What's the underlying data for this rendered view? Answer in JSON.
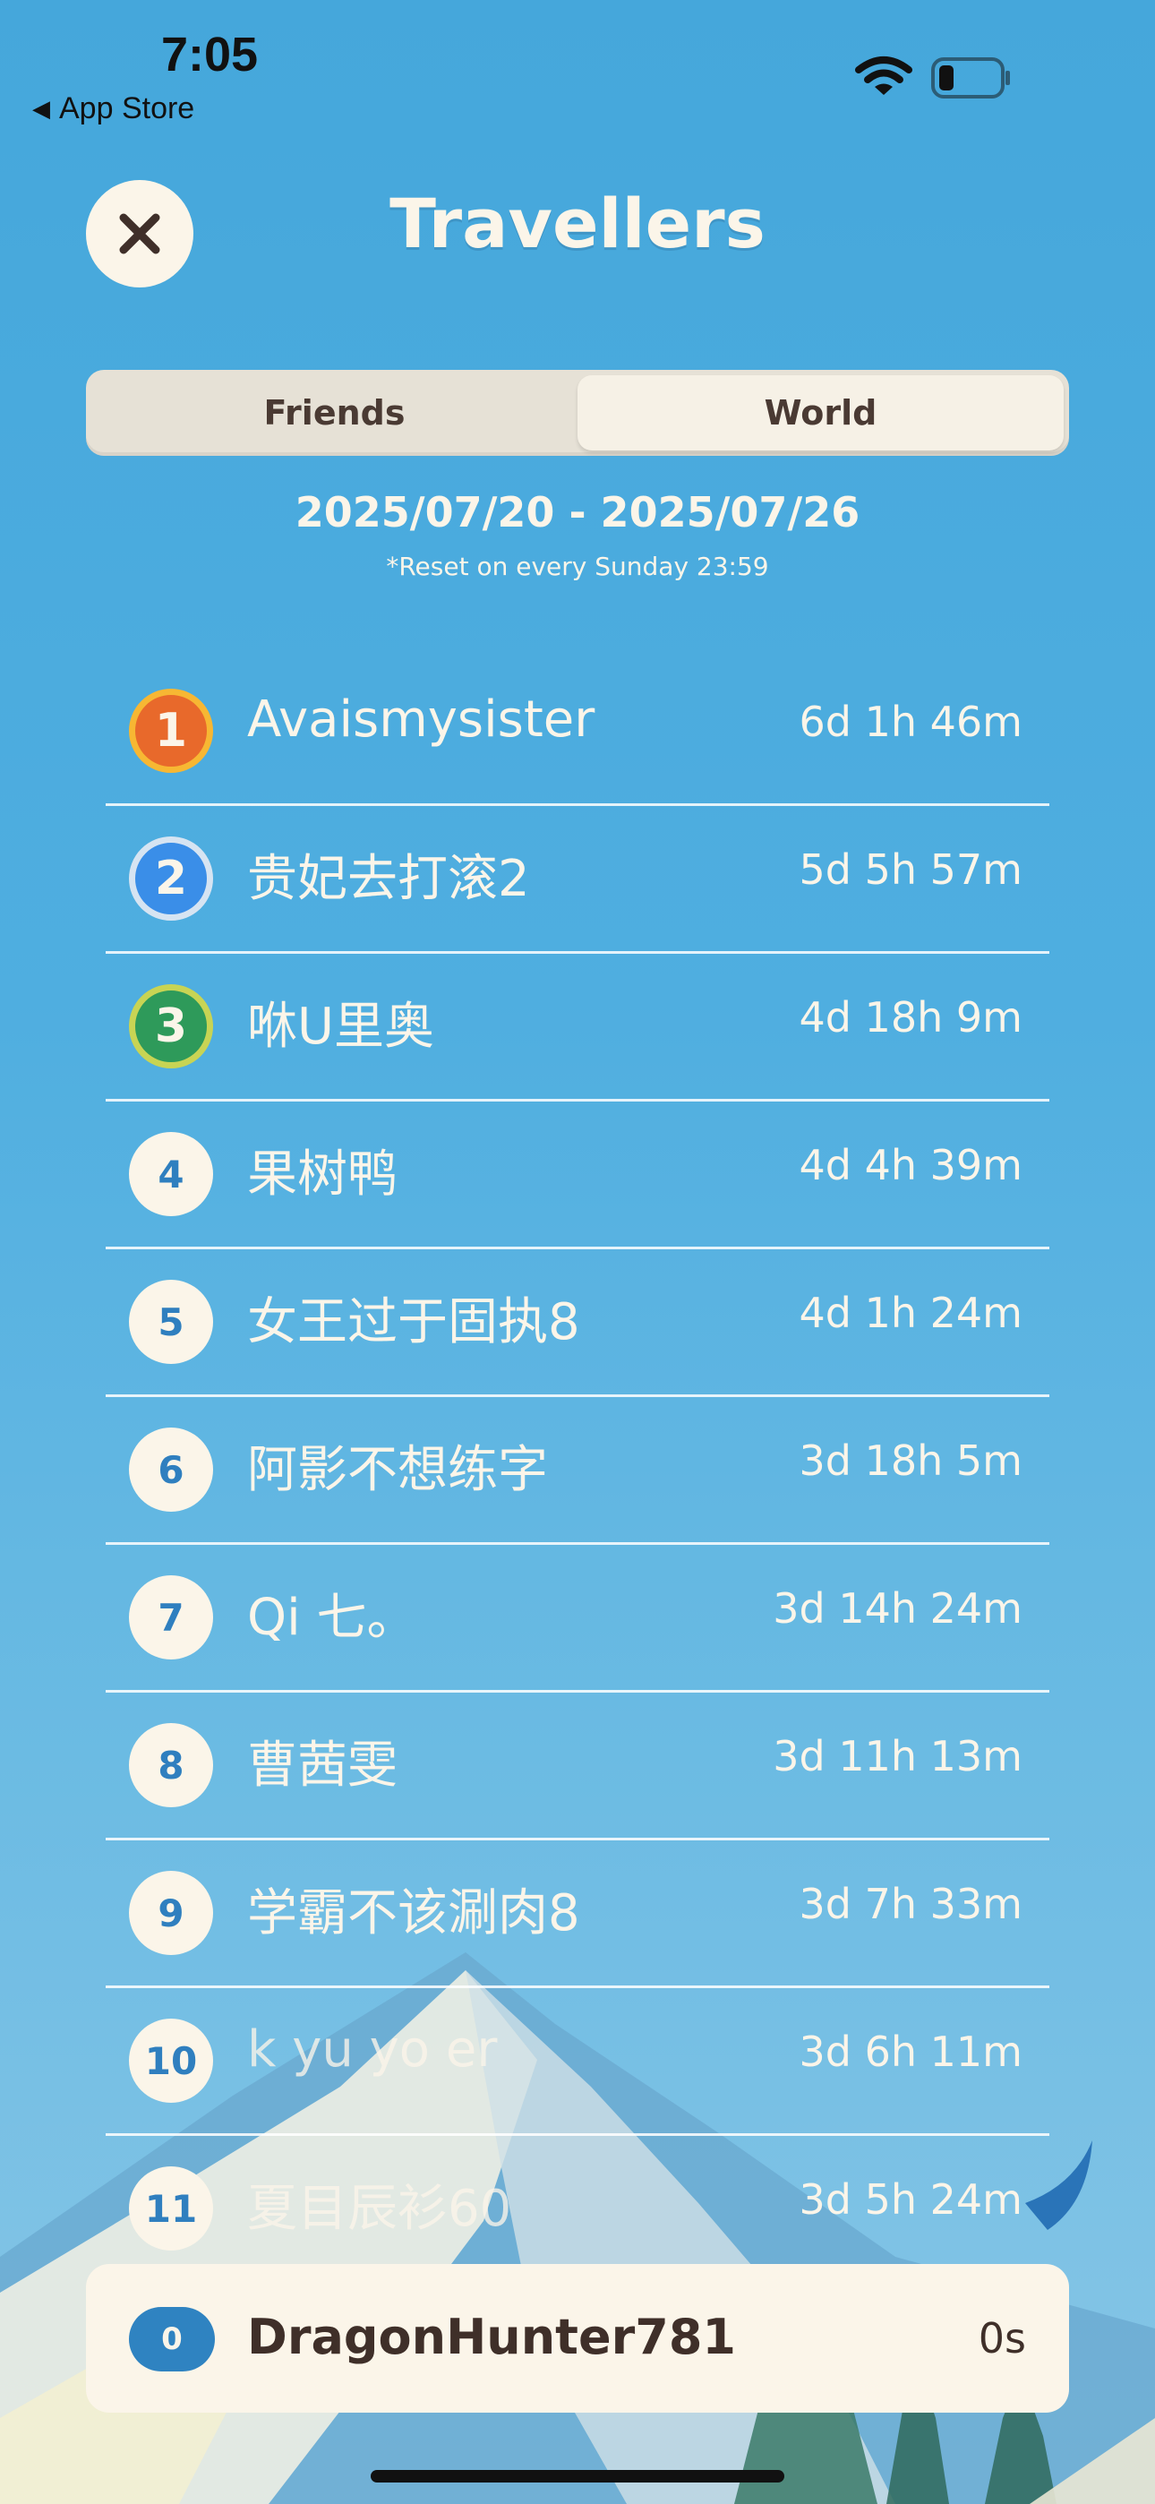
{
  "status_bar": {
    "time": "7:05",
    "back_label": "App Store"
  },
  "header": {
    "title": "Travellers",
    "close_icon": "close-icon"
  },
  "tabs": [
    {
      "label": "Friends",
      "active": false
    },
    {
      "label": "World",
      "active": true
    }
  ],
  "period": {
    "range": "2025/07/20 - 2025/07/26",
    "note": "*Reset on every Sunday 23:59"
  },
  "leaderboard": [
    {
      "rank": "1",
      "name": "Avaismysister",
      "time": "6d 1h 46m"
    },
    {
      "rank": "2",
      "name": "贵妃去打滚2",
      "time": "5d 5h 57m"
    },
    {
      "rank": "3",
      "name": "咻U里奥",
      "time": "4d 18h 9m"
    },
    {
      "rank": "4",
      "name": "果树鸭",
      "time": "4d 4h 39m"
    },
    {
      "rank": "5",
      "name": "女王过于固执8",
      "time": "4d 1h 24m"
    },
    {
      "rank": "6",
      "name": "阿影不想练字",
      "time": "3d 18h 5m"
    },
    {
      "rank": "7",
      "name": "Qi 七。",
      "time": "3d 14h 24m"
    },
    {
      "rank": "8",
      "name": "曹茜雯",
      "time": "3d 11h 13m"
    },
    {
      "rank": "9",
      "name": "学霸不该涮肉8",
      "time": "3d 7h 33m"
    },
    {
      "rank": "10",
      "name": "k yu yo er",
      "time": "3d 6h 11m"
    },
    {
      "rank": "11",
      "name": "夏目辰衫60",
      "time": "3d 5h 24m"
    }
  ],
  "me": {
    "rank": "0",
    "name": "DragonHunter781",
    "time": "0s"
  },
  "colors": {
    "sky": "#45a7db",
    "cream": "#fbf5e9",
    "rank_blue": "#2f7fbf",
    "gold_badge": "#e8692b",
    "silver_badge": "#3a8ee8",
    "bronze_badge": "#2e9a5a"
  }
}
